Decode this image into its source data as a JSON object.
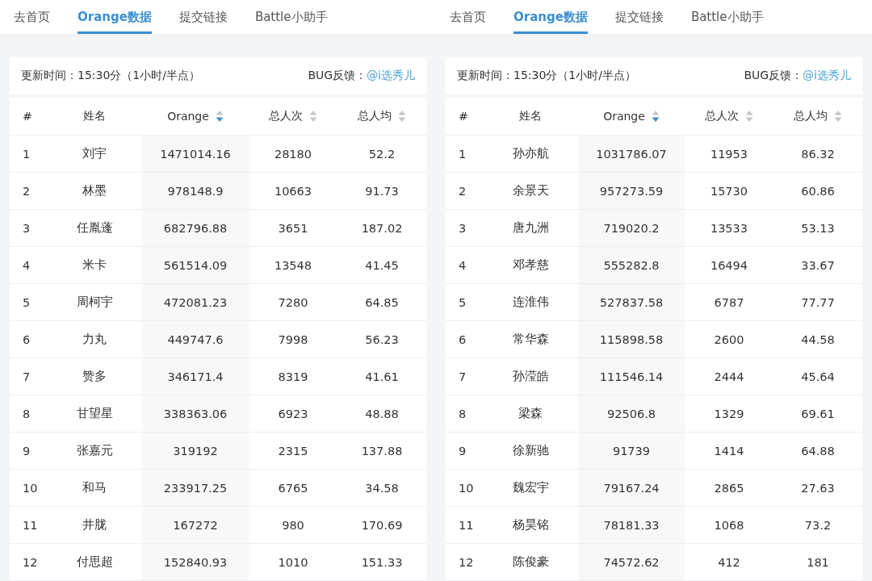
{
  "panels": [
    {
      "tabs": [
        {
          "label": "去首页",
          "selected": false
        },
        {
          "label": "Orange数据",
          "selected": true
        },
        {
          "label": "提交链接",
          "selected": false
        },
        {
          "label": "Battle小助手",
          "selected": false
        }
      ],
      "update_time": "更新时间：15:30分（1小时/半点）",
      "feedback_label": "BUG反馈：",
      "feedback_link": "@i选秀儿",
      "columns": [
        {
          "label": "#"
        },
        {
          "label": "姓名"
        },
        {
          "label": "Orange",
          "sorted": true
        },
        {
          "label": "总人次",
          "sorted": false
        },
        {
          "label": "总人均",
          "sorted": false
        }
      ],
      "rows": [
        [
          "1",
          "刘宇",
          "1471014.16",
          "28180",
          "52.2"
        ],
        [
          "2",
          "林墨",
          "978148.9",
          "10663",
          "91.73"
        ],
        [
          "3",
          "任胤蓬",
          "682796.88",
          "3651",
          "187.02"
        ],
        [
          "4",
          "米卡",
          "561514.09",
          "13548",
          "41.45"
        ],
        [
          "5",
          "周柯宇",
          "472081.23",
          "7280",
          "64.85"
        ],
        [
          "6",
          "力丸",
          "449747.6",
          "7998",
          "56.23"
        ],
        [
          "7",
          "赞多",
          "346171.4",
          "8319",
          "41.61"
        ],
        [
          "8",
          "甘望星",
          "338363.06",
          "6923",
          "48.88"
        ],
        [
          "9",
          "张嘉元",
          "319192",
          "2315",
          "137.88"
        ],
        [
          "10",
          "和马",
          "233917.25",
          "6765",
          "34.58"
        ],
        [
          "11",
          "井胧",
          "167272",
          "980",
          "170.69"
        ],
        [
          "12",
          "付思超",
          "152840.93",
          "1010",
          "151.33"
        ]
      ]
    },
    {
      "tabs": [
        {
          "label": "去首页",
          "selected": false
        },
        {
          "label": "Orange数据",
          "selected": true
        },
        {
          "label": "提交链接",
          "selected": false
        },
        {
          "label": "Battle小助手",
          "selected": false
        }
      ],
      "update_time": "更新时间：15:30分（1小时/半点）",
      "feedback_label": "BUG反馈：",
      "feedback_link": "@i选秀儿",
      "columns": [
        {
          "label": "#"
        },
        {
          "label": "姓名"
        },
        {
          "label": "Orange",
          "sorted": true
        },
        {
          "label": "总人次",
          "sorted": false
        },
        {
          "label": "总人均",
          "sorted": false
        }
      ],
      "rows": [
        [
          "1",
          "孙亦航",
          "1031786.07",
          "11953",
          "86.32"
        ],
        [
          "2",
          "余景天",
          "957273.59",
          "15730",
          "60.86"
        ],
        [
          "3",
          "唐九洲",
          "719020.2",
          "13533",
          "53.13"
        ],
        [
          "4",
          "邓孝慈",
          "555282.8",
          "16494",
          "33.67"
        ],
        [
          "5",
          "连淮伟",
          "527837.58",
          "6787",
          "77.77"
        ],
        [
          "6",
          "常华森",
          "115898.58",
          "2600",
          "44.58"
        ],
        [
          "7",
          "孙滢皓",
          "111546.14",
          "2444",
          "45.64"
        ],
        [
          "8",
          "梁森",
          "92506.8",
          "1329",
          "69.61"
        ],
        [
          "9",
          "徐新驰",
          "91739",
          "1414",
          "64.88"
        ],
        [
          "10",
          "魏宏宇",
          "79167.24",
          "2865",
          "27.63"
        ],
        [
          "11",
          "杨昊铭",
          "78181.33",
          "1068",
          "73.2"
        ],
        [
          "12",
          "陈俊豪",
          "74572.62",
          "412",
          "181"
        ]
      ]
    }
  ]
}
